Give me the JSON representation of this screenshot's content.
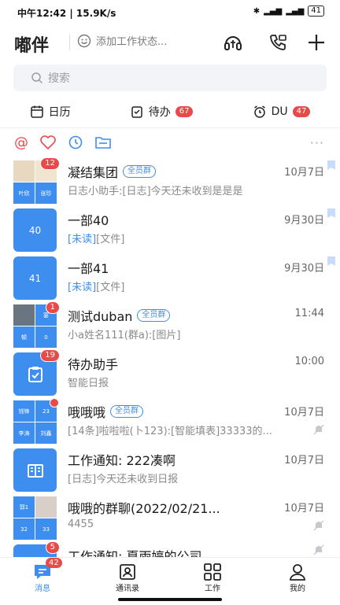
{
  "status_bar": {
    "time_speed": "中午12:42 | 15.9K/s",
    "battery": "41"
  },
  "header": {
    "title": "嘟伴",
    "status_placeholder": "添加工作状态..."
  },
  "search": {
    "placeholder": "搜索"
  },
  "shortcuts": [
    {
      "label": "日历",
      "badge": ""
    },
    {
      "label": "待办",
      "badge": "67"
    },
    {
      "label": "DU",
      "badge": "47"
    }
  ],
  "chats": [
    {
      "name": "凝结集团",
      "tag": "全员群",
      "time": "10月7日",
      "preview": "日志小助手:[日志]今天还未收到是是是",
      "unread": "12",
      "avatar_cells": [
        "",
        "",
        "叶欣",
        "张珍"
      ],
      "pinned": true
    },
    {
      "name": "一部40",
      "tag": "",
      "time": "9月30日",
      "preview_hl": "[未读]",
      "preview": "[文件]",
      "avatar_text": "40",
      "pinned": true
    },
    {
      "name": "一部41",
      "tag": "",
      "time": "9月30日",
      "preview_hl": "[未读]",
      "preview": "[文件]",
      "avatar_text": "41",
      "pinned": true
    },
    {
      "name": "测试duban",
      "tag": "全员群",
      "time": "11:44",
      "preview": "小a姓名111(群a):[图片]",
      "unread": "1",
      "avatar_cells": [
        "",
        "宴",
        "顿",
        "0"
      ]
    },
    {
      "name": "待办助手",
      "tag": "",
      "time": "10:00",
      "preview": "智能日报",
      "unread": "19"
    },
    {
      "name": "哦哦哦",
      "tag": "全员群",
      "time": "10月7日",
      "preview": "[14条]啦啦啦(卜123):[智能填表]33333的...",
      "avatar_cells": [
        "钱锋",
        "23",
        "李涛",
        "刘鑫"
      ],
      "dot": true,
      "muted": true
    },
    {
      "name": "工作通知: 222凑啊",
      "tag": "",
      "time": "10月7日",
      "preview": "[日志]今天还未收到日报"
    },
    {
      "name": "哦哦的群聊(2022/02/21...",
      "tag": "",
      "time": "10月7日",
      "preview": "4455",
      "avatar_cells": [
        "郭1",
        "",
        "32",
        "33"
      ],
      "muted": true
    },
    {
      "name": "工作通知: 夏雨婷的公司",
      "tag": "",
      "time": "",
      "preview": "",
      "unread": "5",
      "muted": true
    }
  ],
  "bottom_nav": [
    {
      "label": "消息",
      "badge": "42"
    },
    {
      "label": "通讯录"
    },
    {
      "label": "工作"
    },
    {
      "label": "我的"
    }
  ],
  "colors": {
    "accent": "#3e8ef0",
    "badge": "#e84a4a",
    "filter_icon": "#e84a4a"
  }
}
